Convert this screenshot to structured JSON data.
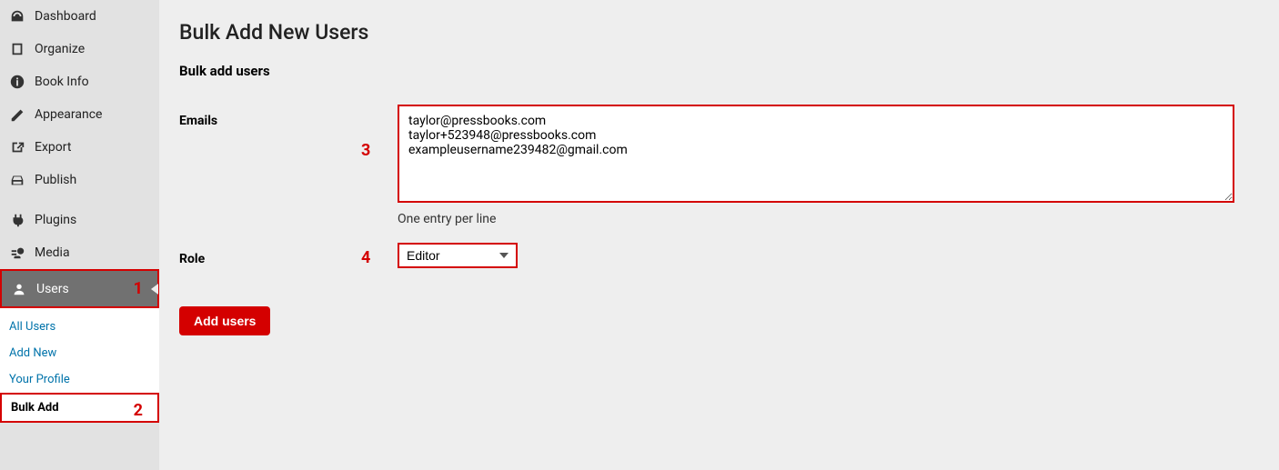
{
  "sidebar": {
    "items": [
      {
        "label": "Dashboard",
        "icon": "dashboard"
      },
      {
        "label": "Organize",
        "icon": "organize"
      },
      {
        "label": "Book Info",
        "icon": "info"
      },
      {
        "label": "Appearance",
        "icon": "appearance"
      },
      {
        "label": "Export",
        "icon": "export"
      },
      {
        "label": "Publish",
        "icon": "publish"
      },
      {
        "label": "Plugins",
        "icon": "plugins"
      },
      {
        "label": "Media",
        "icon": "media"
      },
      {
        "label": "Users",
        "icon": "users"
      }
    ],
    "submenu": [
      {
        "label": "All Users"
      },
      {
        "label": "Add New"
      },
      {
        "label": "Your Profile"
      },
      {
        "label": "Bulk Add"
      }
    ]
  },
  "annotations": {
    "users": "1",
    "bulkadd": "2",
    "emails": "3",
    "role": "4"
  },
  "page": {
    "title": "Bulk Add New Users",
    "section_title": "Bulk add users",
    "emails_label": "Emails",
    "emails_value": "taylor@pressbooks.com\ntaylor+523948@pressbooks.com\nexampleusername239482@gmail.com",
    "emails_helper": "One entry per line",
    "role_label": "Role",
    "role_value": "Editor",
    "submit_label": "Add users"
  }
}
